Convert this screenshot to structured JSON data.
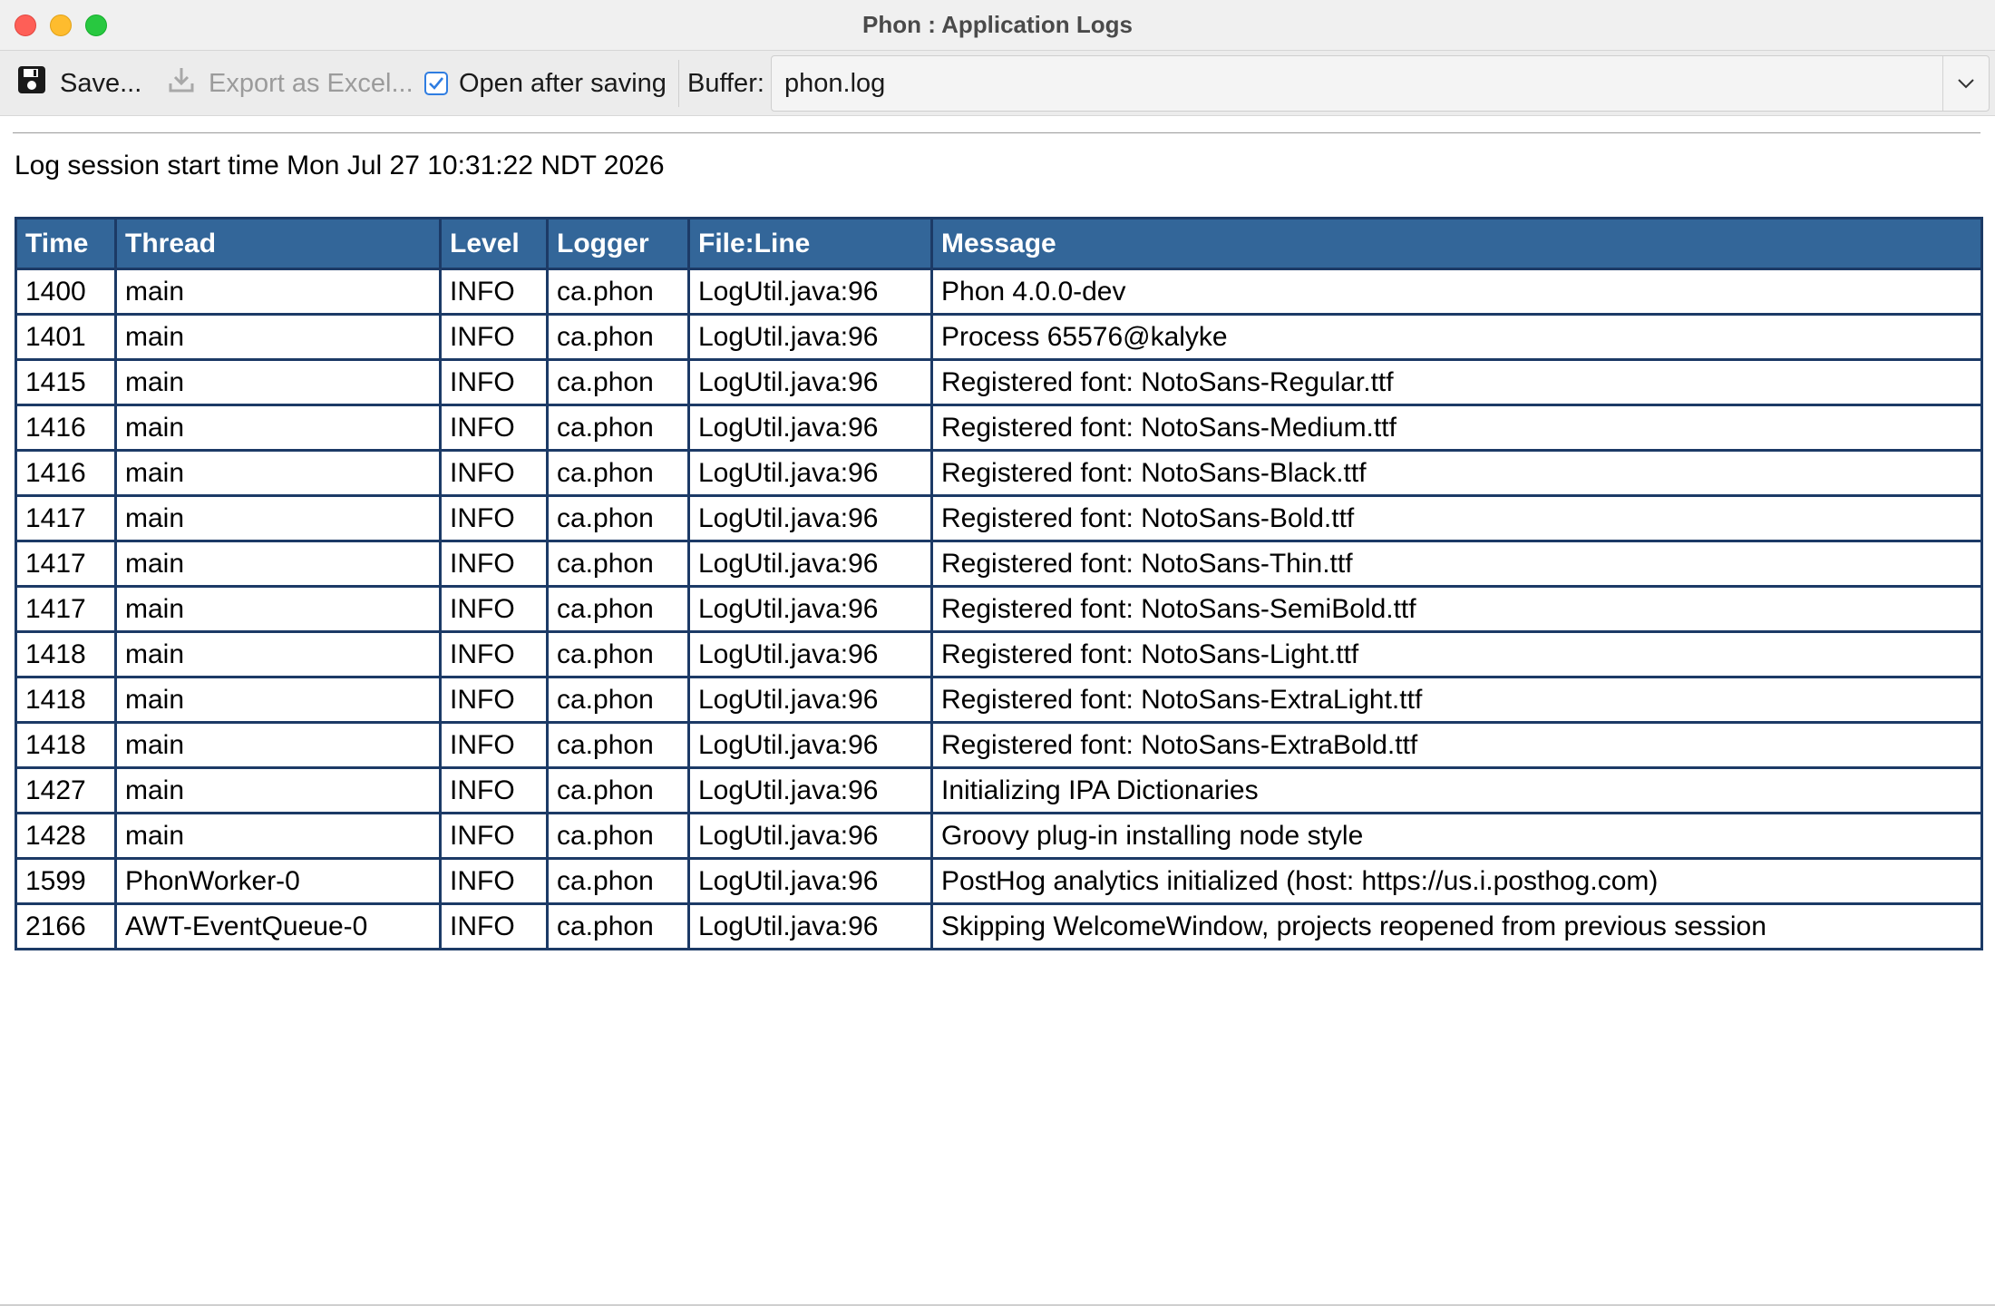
{
  "window": {
    "title": "Phon : Application Logs"
  },
  "toolbar": {
    "save_label": "Save...",
    "export_label": "Export as Excel...",
    "open_after_label": "Open after saving",
    "open_after_checked": true,
    "buffer_label": "Buffer:",
    "buffer_value": "phon.log"
  },
  "log": {
    "session_text": "Log session start time Mon Jul 27 10:31:22 NDT 2026",
    "columns": [
      "Time",
      "Thread",
      "Level",
      "Logger",
      "File:Line",
      "Message"
    ],
    "rows": [
      [
        "1400",
        "main",
        "INFO",
        "ca.phon",
        "LogUtil.java:96",
        "Phon 4.0.0-dev"
      ],
      [
        "1401",
        "main",
        "INFO",
        "ca.phon",
        "LogUtil.java:96",
        "Process 65576@kalyke"
      ],
      [
        "1415",
        "main",
        "INFO",
        "ca.phon",
        "LogUtil.java:96",
        "Registered font: NotoSans-Regular.ttf"
      ],
      [
        "1416",
        "main",
        "INFO",
        "ca.phon",
        "LogUtil.java:96",
        "Registered font: NotoSans-Medium.ttf"
      ],
      [
        "1416",
        "main",
        "INFO",
        "ca.phon",
        "LogUtil.java:96",
        "Registered font: NotoSans-Black.ttf"
      ],
      [
        "1417",
        "main",
        "INFO",
        "ca.phon",
        "LogUtil.java:96",
        "Registered font: NotoSans-Bold.ttf"
      ],
      [
        "1417",
        "main",
        "INFO",
        "ca.phon",
        "LogUtil.java:96",
        "Registered font: NotoSans-Thin.ttf"
      ],
      [
        "1417",
        "main",
        "INFO",
        "ca.phon",
        "LogUtil.java:96",
        "Registered font: NotoSans-SemiBold.ttf"
      ],
      [
        "1418",
        "main",
        "INFO",
        "ca.phon",
        "LogUtil.java:96",
        "Registered font: NotoSans-Light.ttf"
      ],
      [
        "1418",
        "main",
        "INFO",
        "ca.phon",
        "LogUtil.java:96",
        "Registered font: NotoSans-ExtraLight.ttf"
      ],
      [
        "1418",
        "main",
        "INFO",
        "ca.phon",
        "LogUtil.java:96",
        "Registered font: NotoSans-ExtraBold.ttf"
      ],
      [
        "1427",
        "main",
        "INFO",
        "ca.phon",
        "LogUtil.java:96",
        "Initializing IPA Dictionaries"
      ],
      [
        "1428",
        "main",
        "INFO",
        "ca.phon",
        "LogUtil.java:96",
        "Groovy plug-in installing node style"
      ],
      [
        "1599",
        "PhonWorker-0",
        "INFO",
        "ca.phon",
        "LogUtil.java:96",
        "PostHog analytics initialized (host: https://us.i.posthog.com)"
      ],
      [
        "2166",
        "AWT-EventQueue-0",
        "INFO",
        "ca.phon",
        "LogUtil.java:96",
        "Skipping WelcomeWindow, projects reopened from previous session"
      ]
    ]
  },
  "colors": {
    "header_bg": "#336699",
    "grid": "#1c3a66",
    "checkbox_accent": "#2f7de1"
  },
  "icons": {
    "save": "floppy-disk-icon",
    "export": "download-tray-icon",
    "checkbox": "checkmark-icon",
    "dropdown": "chevron-down-icon"
  }
}
